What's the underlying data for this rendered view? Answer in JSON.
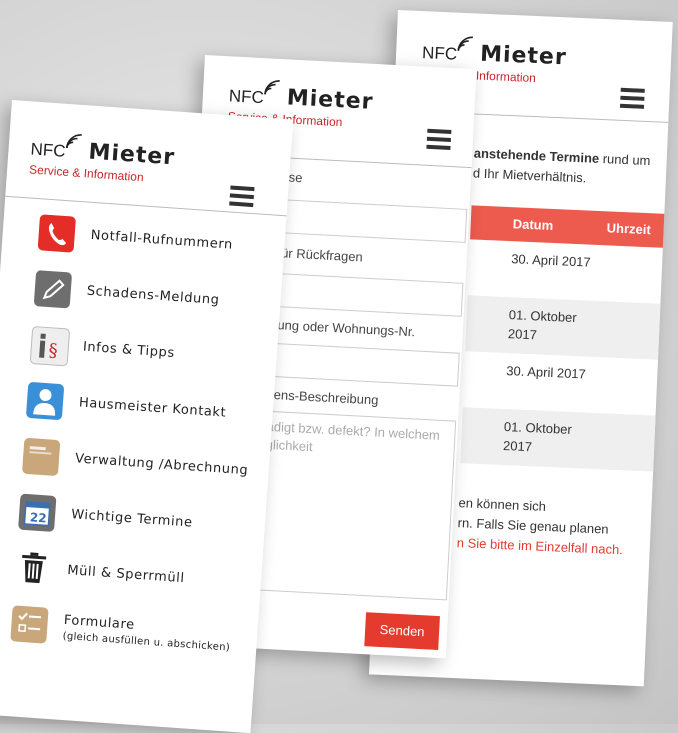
{
  "brand": {
    "nfc": "NFC",
    "name": "Mieter",
    "subtitle": "Service & Information"
  },
  "colors": {
    "accent_red": "#e53b2f",
    "table_header": "#ec5b4e"
  },
  "termine": {
    "intro_bold": "anstehende Termine",
    "intro_rest": " rund um",
    "intro_line2": "d Ihr Mietverhältnis.",
    "col_date": "Datum",
    "col_time": "Uhrzeit",
    "rows": [
      {
        "date": "30. April 2017"
      },
      {
        "date": "01. Oktober 2017"
      },
      {
        "date": "30. April 2017"
      },
      {
        "date": "01. Oktober 2017"
      }
    ],
    "foot_line1": "en können sich",
    "foot_line2": "rn. Falls Sie genau planen",
    "foot_line3": "n Sie bitte im Einzelfall nach."
  },
  "form": {
    "label_address": "resse",
    "label_phone": "r. für Rückfragen",
    "label_flat": "nnung oder Wohnungs-Nr.",
    "label_description": "adens-Beschreibung",
    "placeholder_line1": "ädigt bzw. defekt? In welchem",
    "placeholder_line2": "glichkeit",
    "send_label": "Senden"
  },
  "menu": {
    "items": [
      {
        "label": "Notfall-Rufnummern",
        "icon": "phone-icon"
      },
      {
        "label": "Schadens-Meldung",
        "icon": "pencil-icon"
      },
      {
        "label": "Infos & Tipps",
        "icon": "info-paragraph-icon"
      },
      {
        "label": "Hausmeister Kontakt",
        "icon": "person-icon"
      },
      {
        "label": "Verwaltung /Abrechnung",
        "icon": "folder-icon"
      },
      {
        "label": "Wichtige Termine",
        "icon": "calendar-icon",
        "calendar_day": "22"
      },
      {
        "label": "Müll & Sperrmüll",
        "icon": "trash-icon"
      },
      {
        "label": "Formulare",
        "sublabel": "(gleich ausfüllen u. abschicken)",
        "icon": "checklist-icon"
      }
    ]
  }
}
